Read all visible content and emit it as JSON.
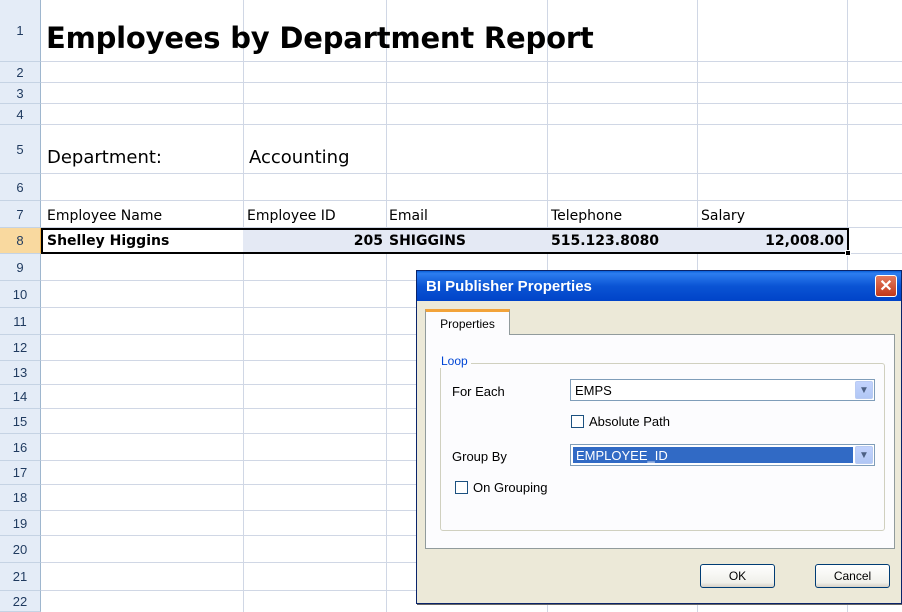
{
  "sheet": {
    "row_numbers": [
      "1",
      "2",
      "3",
      "4",
      "5",
      "6",
      "7",
      "8",
      "9",
      "10",
      "11",
      "12",
      "13",
      "14",
      "15",
      "16",
      "17",
      "18",
      "19",
      "20",
      "21",
      "22"
    ],
    "title": "Employees by Department Report",
    "department_label": "Department:",
    "department_value": "Accounting",
    "columns": {
      "employee_name": "Employee Name",
      "employee_id": "Employee ID",
      "email": "Email",
      "telephone": "Telephone",
      "salary": "Salary"
    },
    "row8": {
      "employee_name": "Shelley Higgins",
      "employee_id": "205",
      "email": "SHIGGINS",
      "telephone": "515.123.8080",
      "salary": "12,008.00"
    }
  },
  "dialog": {
    "title": "BI Publisher Properties",
    "close_glyph": "✕",
    "tab_label": "Properties",
    "group_label": "Loop",
    "for_each_label": "For Each",
    "for_each_value": "EMPS",
    "absolute_path_label": "Absolute Path",
    "group_by_label": "Group By",
    "group_by_value": "EMPLOYEE_ID",
    "on_grouping_label": "On Grouping",
    "ok_label": "OK",
    "cancel_label": "Cancel",
    "dropdown_glyph": "▼"
  },
  "colors": {
    "titlebar": "#0054e3",
    "selection": "#316ac5",
    "active_row_header": "#f9d99f"
  }
}
